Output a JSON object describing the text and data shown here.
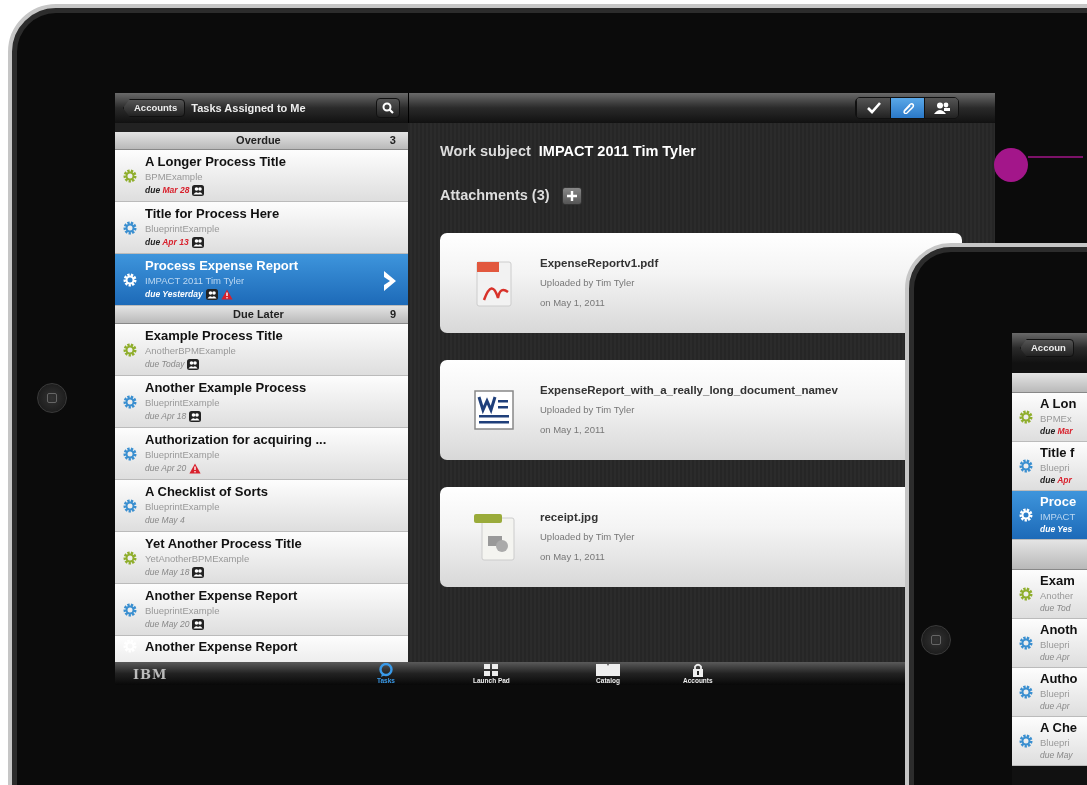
{
  "tablet": {
    "nav": {
      "back_button": "Accounts",
      "title": "Tasks Assigned to Me"
    },
    "detail_toolbar": [
      {
        "kind": "complete",
        "selected": false
      },
      {
        "kind": "attachments",
        "selected": true
      },
      {
        "kind": "people",
        "selected": false
      }
    ],
    "sections": [
      {
        "title": "Overdue",
        "count": "3",
        "tasks": [
          {
            "title": "A Longer Process Title",
            "source": "BPMExample",
            "due_label": "due",
            "due_date": "Mar 28",
            "overdue": true,
            "color": "#8fae2c",
            "selected": false,
            "assigned": true,
            "warning": false
          },
          {
            "title": "Title for Process Here",
            "source": "BlueprintExample",
            "due_label": "due",
            "due_date": "Apr 13",
            "overdue": true,
            "color": "#3a8fd0",
            "selected": false,
            "assigned": true,
            "warning": false
          },
          {
            "title": "Process Expense Report",
            "source": "IMPACT 2011 Tim Tyler",
            "due_label": "due",
            "due_date": "Yesterday",
            "overdue": true,
            "selected": true,
            "assigned": true,
            "warning": true
          }
        ]
      },
      {
        "title": "Due Later",
        "count": "9",
        "tasks": [
          {
            "title": "Example Process Title",
            "source": "AnotherBPMExample",
            "due_label": "due",
            "due_date": "Today",
            "overdue": false,
            "color": "#8fae2c",
            "selected": false,
            "assigned": true,
            "warning": false
          },
          {
            "title": "Another Example Process",
            "source": "BlueprintExample",
            "due_label": "due",
            "due_date": "Apr 18",
            "overdue": false,
            "color": "#3a8fd0",
            "selected": false,
            "assigned": true,
            "warning": false
          },
          {
            "title": "Authorization for acquiring ...",
            "source": "BlueprintExample",
            "due_label": "due",
            "due_date": "Apr 20",
            "overdue": false,
            "color": "#3a8fd0",
            "selected": false,
            "assigned": false,
            "warning": true
          },
          {
            "title": "A Checklist of Sorts",
            "source": "BlueprintExample",
            "due_label": "due",
            "due_date": "May 4",
            "overdue": false,
            "color": "#3a8fd0",
            "selected": false,
            "assigned": false,
            "warning": false
          },
          {
            "title": "Yet Another Process Title",
            "source": "YetAnotherBPMExample",
            "due_label": "due",
            "due_date": "May 18",
            "overdue": false,
            "color": "#8fae2c",
            "selected": false,
            "assigned": true,
            "warning": false
          },
          {
            "title": "Another Expense Report",
            "source": "BlueprintExample",
            "due_label": "due",
            "due_date": "May 20",
            "overdue": false,
            "color": "#3a8fd0",
            "selected": false,
            "assigned": true,
            "warning": false
          },
          {
            "title": "Another Expense Report",
            "selected": false
          }
        ]
      }
    ],
    "detail": {
      "label": "Work subject",
      "subject": "IMPACT 2011 Tim Tyler",
      "attachments_heading": "Attachments (3)",
      "attachments": [
        {
          "kind": "pdf",
          "name": "ExpenseReportv1.pdf",
          "uploader": "Uploaded by Tim Tyler",
          "date": "on May 1, 2011"
        },
        {
          "kind": "word",
          "name": "ExpenseReport_with_a_really_long_document_namev",
          "uploader": "Uploaded by Tim Tyler",
          "date": "on May 1, 2011"
        },
        {
          "kind": "image",
          "name": "receipt.jpg",
          "uploader": "Uploaded by Tim Tyler",
          "date": "on May 1, 2011"
        }
      ]
    },
    "tab_bar": {
      "logo": "IBM",
      "tabs": [
        {
          "kind": "tasks",
          "label": "Tasks",
          "selected": true
        },
        {
          "kind": "launchpad",
          "label": "Launch Pad",
          "selected": false
        },
        {
          "kind": "catalog",
          "label": "Catalog",
          "selected": false
        },
        {
          "kind": "accounts",
          "label": "Accounts",
          "selected": false
        }
      ]
    }
  },
  "second_tablet": {
    "nav": {
      "back_button": "Accoun"
    },
    "sections": [
      {
        "tasks": [
          {
            "title": "A Lon",
            "source": "BPMEx",
            "due_label": "due",
            "due_date": "Mar",
            "overdue": true,
            "color": "#8fae2c",
            "selected": false
          },
          {
            "title": "Title f",
            "source": "Bluepri",
            "due_label": "due",
            "due_date": "Apr",
            "overdue": true,
            "color": "#3a8fd0",
            "selected": false
          },
          {
            "title": "Proce",
            "source": "IMPACT",
            "due_label": "due",
            "due_date": "Yes",
            "overdue": true,
            "selected": true
          }
        ]
      },
      {
        "tasks": [
          {
            "title": "Exam",
            "source": "Another",
            "due_label": "due",
            "due_date": "Tod",
            "overdue": false,
            "color": "#8fae2c",
            "selected": false
          },
          {
            "title": "Anoth",
            "source": "Bluepri",
            "due_label": "due",
            "due_date": "Apr",
            "overdue": false,
            "color": "#3a8fd0",
            "selected": false
          },
          {
            "title": "Autho",
            "source": "Bluepri",
            "due_label": "due",
            "due_date": "Apr",
            "overdue": false,
            "color": "#3a8fd0",
            "selected": false
          },
          {
            "title": "A Che",
            "source": "Bluepri",
            "due_label": "due",
            "due_date": "May",
            "overdue": false,
            "color": "#3a8fd0",
            "selected": false
          }
        ]
      }
    ]
  }
}
